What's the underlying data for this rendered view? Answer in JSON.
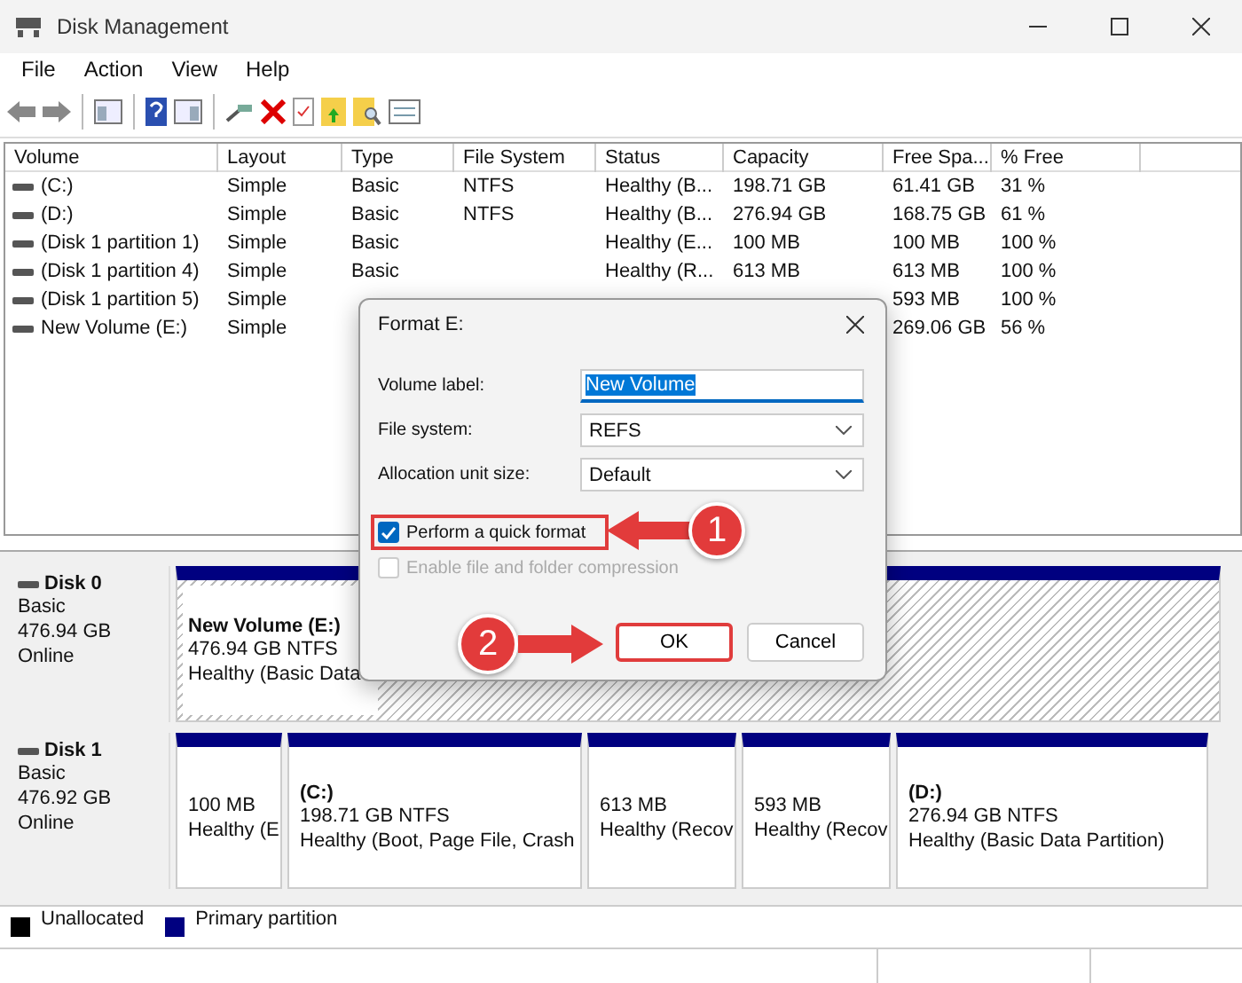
{
  "window": {
    "title": "Disk Management"
  },
  "menu": [
    "File",
    "Action",
    "View",
    "Help"
  ],
  "volume_table": {
    "columns": [
      "Volume",
      "Layout",
      "Type",
      "File System",
      "Status",
      "Capacity",
      "Free Spa...",
      "% Free"
    ],
    "rows": [
      {
        "volume": "(C:)",
        "layout": "Simple",
        "type": "Basic",
        "file_system": "NTFS",
        "status": "Healthy (B...",
        "capacity": "198.71 GB",
        "free_space": "61.41 GB",
        "percent_free": "31 %"
      },
      {
        "volume": "(D:)",
        "layout": "Simple",
        "type": "Basic",
        "file_system": "NTFS",
        "status": "Healthy (B...",
        "capacity": "276.94 GB",
        "free_space": "168.75 GB",
        "percent_free": "61 %"
      },
      {
        "volume": "(Disk 1 partition 1)",
        "layout": "Simple",
        "type": "Basic",
        "status": "Healthy (E...",
        "capacity": "100 MB",
        "free_space": "100 MB",
        "percent_free": "100 %"
      },
      {
        "volume": "(Disk 1 partition 4)",
        "layout": "Simple",
        "type": "Basic",
        "status": "Healthy (R...",
        "capacity": "613 MB",
        "free_space": "613 MB",
        "percent_free": "100 %"
      },
      {
        "volume": "(Disk 1 partition 5)",
        "layout": "Simple",
        "free_space": "593 MB",
        "percent_free": "100 %"
      },
      {
        "volume": "New Volume (E:)",
        "layout": "Simple",
        "free_space": "269.06 GB",
        "percent_free": "56 %"
      }
    ]
  },
  "disks": [
    {
      "name": "Disk 0",
      "type": "Basic",
      "size": "476.94 GB",
      "status": "Online",
      "partitions": [
        {
          "label": "New Volume  (E:)",
          "size": "476.94 GB NTFS",
          "health": "Healthy (Basic Data",
          "selected": true
        }
      ]
    },
    {
      "name": "Disk 1",
      "type": "Basic",
      "size": "476.92 GB",
      "status": "Online",
      "partitions": [
        {
          "size": "100 MB",
          "health": "Healthy (E",
          "selected": false
        },
        {
          "label": "(C:)",
          "size": "198.71 GB NTFS",
          "health": "Healthy (Boot, Page File, Crash",
          "selected": false
        },
        {
          "size": "613 MB",
          "health": "Healthy (Recov",
          "selected": false
        },
        {
          "size": "593 MB",
          "health": "Healthy (Recov",
          "selected": false
        },
        {
          "label": "(D:)",
          "size": "276.94 GB NTFS",
          "health": "Healthy (Basic Data Partition)",
          "selected": false
        }
      ]
    }
  ],
  "legend": [
    {
      "label": "Unallocated",
      "color": "#000000"
    },
    {
      "label": "Primary partition",
      "color": "#000080"
    }
  ],
  "dialog": {
    "title": "Format E:",
    "fields": [
      {
        "kind": "text",
        "label": "Volume label:",
        "value": "New Volume"
      },
      {
        "kind": "select",
        "label": "File system:",
        "value": "REFS"
      },
      {
        "kind": "select",
        "label": "Allocation unit size:",
        "value": "Default"
      }
    ],
    "checkboxes": [
      {
        "label": "Perform a quick format",
        "checked": true,
        "disabled": false
      },
      {
        "label": "Enable file and folder compression",
        "checked": false,
        "disabled": true
      }
    ],
    "buttons": [
      {
        "label": "OK",
        "highlighted": true
      },
      {
        "label": "Cancel",
        "highlighted": false
      }
    ]
  },
  "callouts": [
    "1",
    "2"
  ]
}
